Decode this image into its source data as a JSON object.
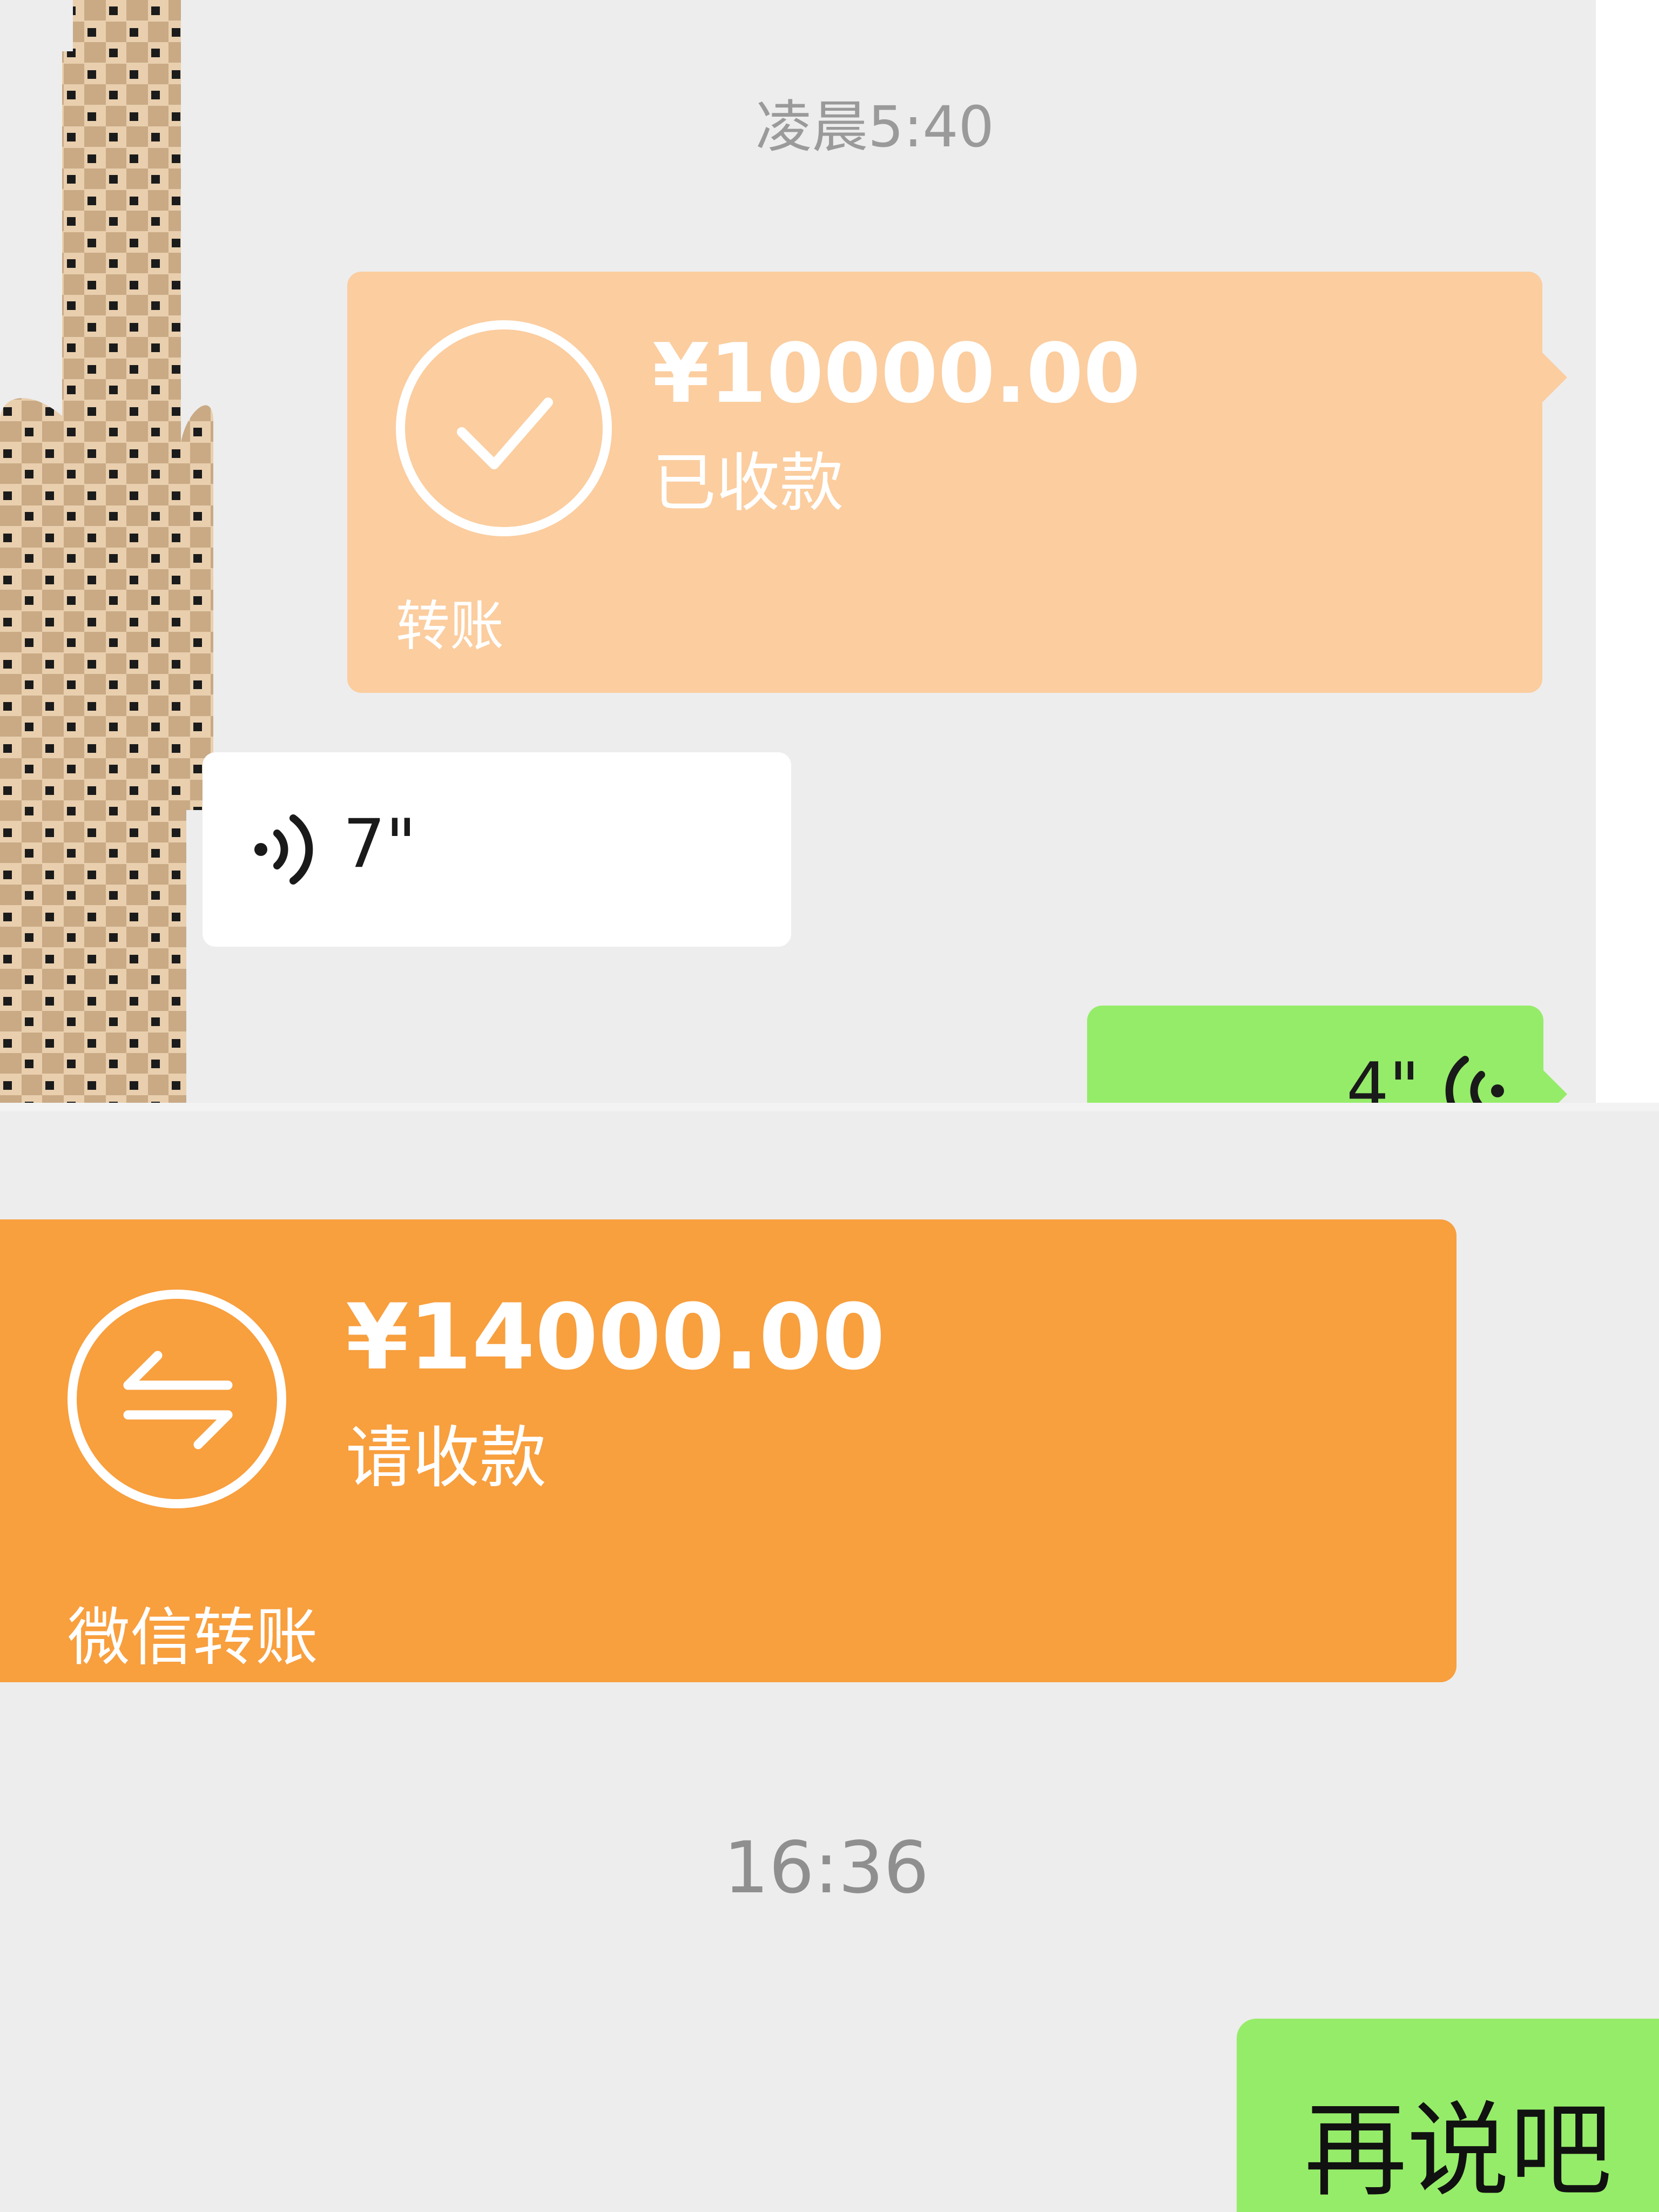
{
  "top_screenshot": {
    "timestamp": "凌晨5:40",
    "transfer_received": {
      "amount": "¥10000.00",
      "status": "已收款",
      "label": "转账",
      "icon": "check-circle-icon",
      "color": "#fbcd9f"
    },
    "voice_incoming": {
      "duration": "7\"",
      "icon": "voice-wave-icon"
    },
    "voice_outgoing": {
      "duration": "4\"",
      "icon": "voice-wave-icon",
      "color": "#95ec69"
    }
  },
  "bottom_screenshot": {
    "transfer_request": {
      "amount": "¥14000.00",
      "status": "请收款",
      "label": "微信转账",
      "icon": "exchange-arrows-icon",
      "color": "#f89f3e"
    },
    "timestamp": "16:36",
    "text_outgoing": {
      "text": "再说吧",
      "color": "#95ec69"
    }
  }
}
